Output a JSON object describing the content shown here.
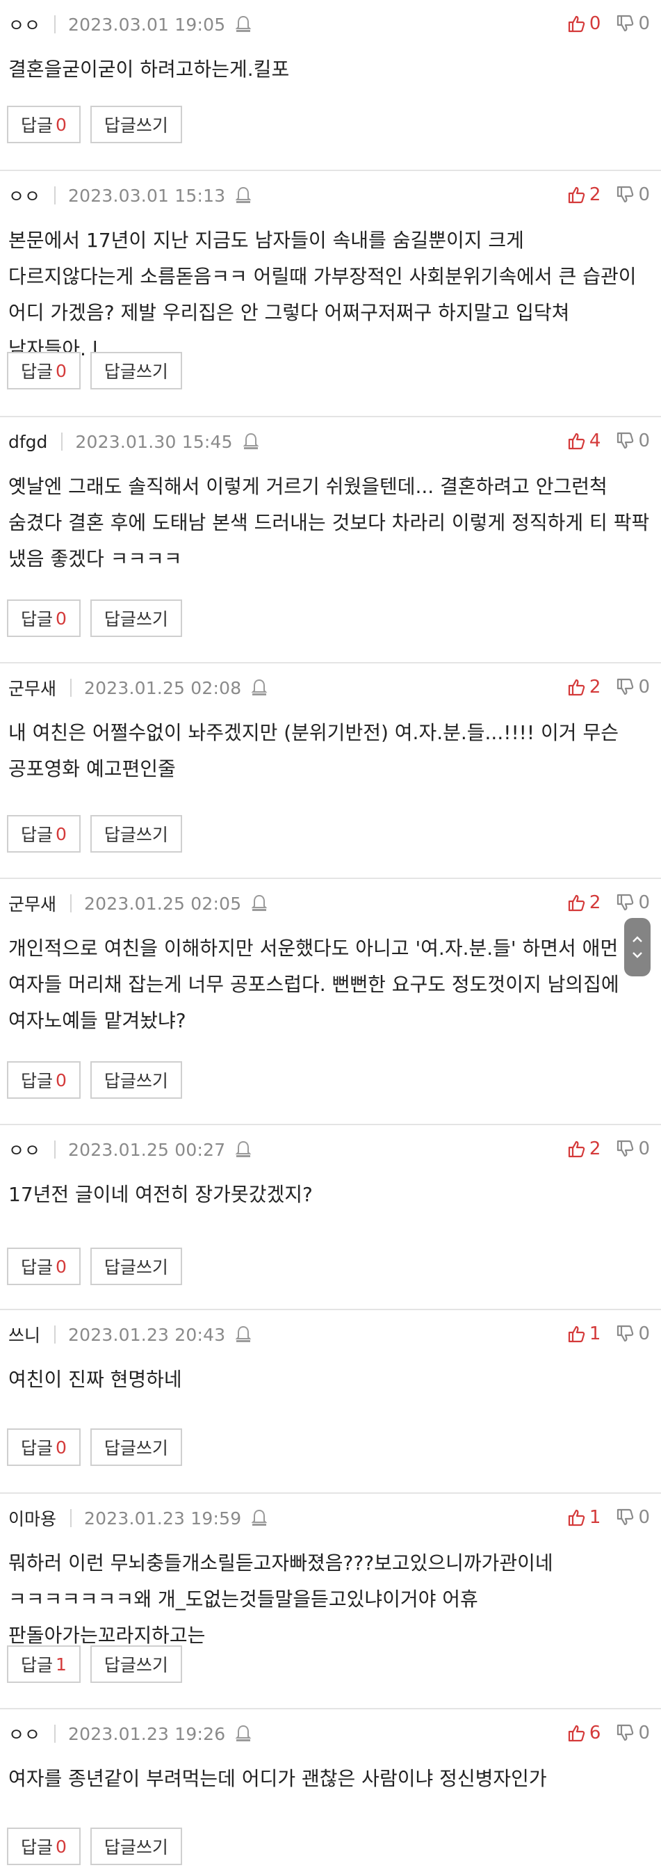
{
  "reply_label": "답글",
  "write_reply_label": "답글쓰기",
  "comments": [
    {
      "author": "ㅇㅇ",
      "date": "2023.03.01 19:05",
      "up": "0",
      "down": "0",
      "text": "결혼을굳이굳이 하려고하는게.킬포",
      "reply_count": "0"
    },
    {
      "author": "ㅇㅇ",
      "date": "2023.03.01 15:13",
      "up": "2",
      "down": "0",
      "text": "본문에서 17년이 지난 지금도 남자들이 속내를 숨길뿐이지 크게 다르지않다는게 소름돋음ㅋㅋ 어릴때 가부장적인 사회분위기속에서 큰 습관이 어디 가겠음? 제발 우리집은 안 그렇다 어쩌구저쩌구 하지말고 입닥쳐 남자들아. l",
      "reply_count": "0"
    },
    {
      "author": "dfgd",
      "date": "2023.01.30 15:45",
      "up": "4",
      "down": "0",
      "text": "옛날엔 그래도 솔직해서 이렇게 거르기 쉬웠을텐데... 결혼하려고 안그런척 숨겼다 결혼 후에 도태남 본색 드러내는 것보다 차라리 이렇게 정직하게 티 팍팍 냈음 좋겠다 ㅋㅋㅋㅋ",
      "reply_count": "0"
    },
    {
      "author": "군무새",
      "date": "2023.01.25 02:08",
      "up": "2",
      "down": "0",
      "text": "내 여친은 어쩔수없이 놔주겠지만 (분위기반전) 여.자.분.들...!!!! 이거 무슨 공포영화 예고편인줄",
      "reply_count": "0"
    },
    {
      "author": "군무새",
      "date": "2023.01.25 02:05",
      "up": "2",
      "down": "0",
      "text": "개인적으로 여친을 이해하지만 서운했다도 아니고 '여.자.분.들' 하면서 애먼 여자들 머리채 잡는게 너무 공포스럽다. 뻔뻔한 요구도 정도껏이지 남의집에 여자노예들 맡겨놨냐?",
      "reply_count": "0"
    },
    {
      "author": "ㅇㅇ",
      "date": "2023.01.25 00:27",
      "up": "2",
      "down": "0",
      "text": "17년전 글이네 여전히 장가못갔겠지?",
      "reply_count": "0"
    },
    {
      "author": "쓰니",
      "date": "2023.01.23 20:43",
      "up": "1",
      "down": "0",
      "text": "여친이 진짜 현명하네",
      "reply_count": "0"
    },
    {
      "author": "이마용",
      "date": "2023.01.23 19:59",
      "up": "1",
      "down": "0",
      "text": "뭐하러 이런 무뇌충들개소릴듣고자빠졌음???보고있으니까가관이네 ㅋㅋㅋㅋㅋㅋㅋ왜 개_도없는것들말을듣고있냐이거야 어휴 판돌아가는꼬라지하고는",
      "reply_count": "1"
    },
    {
      "author": "ㅇㅇ",
      "date": "2023.01.23 19:26",
      "up": "6",
      "down": "0",
      "text": "여자를 종년같이 부려먹는데 어디가 괜찮은 사람이냐 정신병자인가",
      "reply_count": "0"
    }
  ]
}
